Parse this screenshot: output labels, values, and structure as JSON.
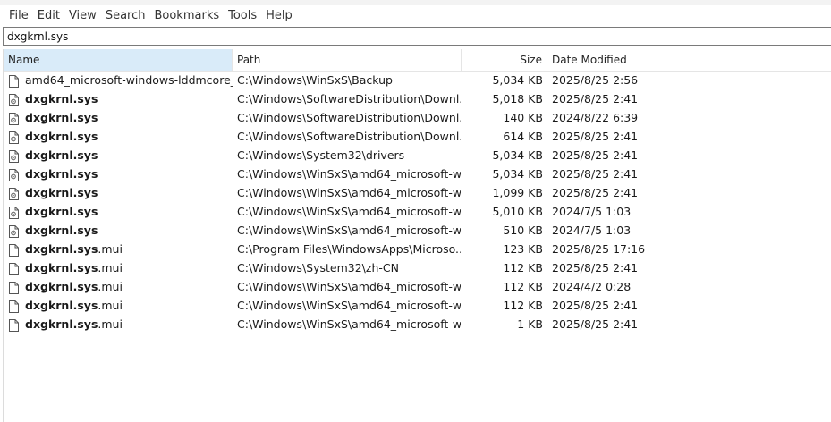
{
  "menu": [
    "File",
    "Edit",
    "View",
    "Search",
    "Bookmarks",
    "Tools",
    "Help"
  ],
  "search": {
    "value": "dxgkrnl.sys"
  },
  "columns": {
    "name": "Name",
    "path": "Path",
    "size": "Size",
    "date": "Date Modified"
  },
  "rows": [
    {
      "icon": "blank-file-icon",
      "name_bold": "",
      "name_rest": "amd64_microsoft-windows-lddmcore_...",
      "path": "C:\\Windows\\WinSxS\\Backup",
      "size": "5,034 KB",
      "date": "2025/8/25 2:56"
    },
    {
      "icon": "system-file-icon",
      "name_bold": "dxgkrnl.sys",
      "name_rest": "",
      "path": "C:\\Windows\\SoftwareDistribution\\Downl...",
      "size": "5,018 KB",
      "date": "2025/8/25 2:41"
    },
    {
      "icon": "system-file-icon",
      "name_bold": "dxgkrnl.sys",
      "name_rest": "",
      "path": "C:\\Windows\\SoftwareDistribution\\Downl...",
      "size": "140 KB",
      "date": "2024/8/22 6:39"
    },
    {
      "icon": "system-file-icon",
      "name_bold": "dxgkrnl.sys",
      "name_rest": "",
      "path": "C:\\Windows\\SoftwareDistribution\\Downl...",
      "size": "614 KB",
      "date": "2025/8/25 2:41"
    },
    {
      "icon": "system-file-icon",
      "name_bold": "dxgkrnl.sys",
      "name_rest": "",
      "path": "C:\\Windows\\System32\\drivers",
      "size": "5,034 KB",
      "date": "2025/8/25 2:41"
    },
    {
      "icon": "system-file-icon",
      "name_bold": "dxgkrnl.sys",
      "name_rest": "",
      "path": "C:\\Windows\\WinSxS\\amd64_microsoft-wi...",
      "size": "5,034 KB",
      "date": "2025/8/25 2:41"
    },
    {
      "icon": "system-file-icon",
      "name_bold": "dxgkrnl.sys",
      "name_rest": "",
      "path": "C:\\Windows\\WinSxS\\amd64_microsoft-wi...",
      "size": "1,099 KB",
      "date": "2025/8/25 2:41"
    },
    {
      "icon": "system-file-icon",
      "name_bold": "dxgkrnl.sys",
      "name_rest": "",
      "path": "C:\\Windows\\WinSxS\\amd64_microsoft-wi...",
      "size": "5,010 KB",
      "date": "2024/7/5 1:03"
    },
    {
      "icon": "system-file-icon",
      "name_bold": "dxgkrnl.sys",
      "name_rest": "",
      "path": "C:\\Windows\\WinSxS\\amd64_microsoft-wi...",
      "size": "510 KB",
      "date": "2024/7/5 1:03"
    },
    {
      "icon": "blank-file-icon",
      "name_bold": "dxgkrnl.sys",
      "name_rest": ".mui",
      "path": "C:\\Program Files\\WindowsApps\\Microso...",
      "size": "123 KB",
      "date": "2025/8/25 17:16"
    },
    {
      "icon": "blank-file-icon",
      "name_bold": "dxgkrnl.sys",
      "name_rest": ".mui",
      "path": "C:\\Windows\\System32\\zh-CN",
      "size": "112 KB",
      "date": "2025/8/25 2:41"
    },
    {
      "icon": "blank-file-icon",
      "name_bold": "dxgkrnl.sys",
      "name_rest": ".mui",
      "path": "C:\\Windows\\WinSxS\\amd64_microsoft-wi...",
      "size": "112 KB",
      "date": "2024/4/2 0:28"
    },
    {
      "icon": "blank-file-icon",
      "name_bold": "dxgkrnl.sys",
      "name_rest": ".mui",
      "path": "C:\\Windows\\WinSxS\\amd64_microsoft-wi...",
      "size": "112 KB",
      "date": "2025/8/25 2:41"
    },
    {
      "icon": "blank-file-icon",
      "name_bold": "dxgkrnl.sys",
      "name_rest": ".mui",
      "path": "C:\\Windows\\WinSxS\\amd64_microsoft-wi...",
      "size": "1 KB",
      "date": "2025/8/25 2:41"
    }
  ]
}
